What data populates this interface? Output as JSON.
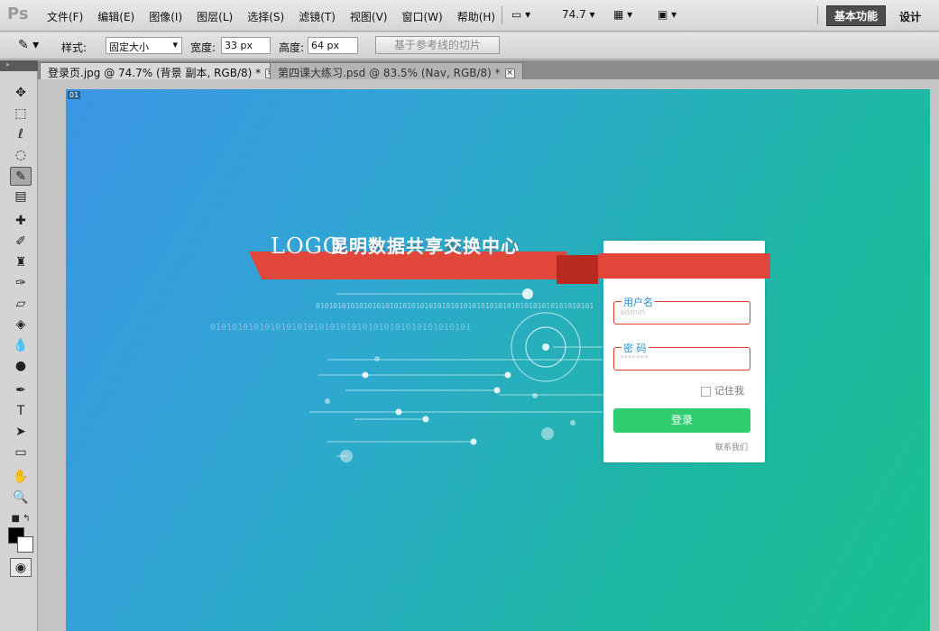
{
  "app": {
    "logo": "Ps"
  },
  "menu": [
    "文件(F)",
    "编辑(E)",
    "图像(I)",
    "图层(L)",
    "选择(S)",
    "滤镜(T)",
    "视图(V)",
    "窗口(W)",
    "帮助(H)"
  ],
  "menubar": {
    "zoom": "74.7",
    "workspace_active": "基本功能",
    "workspace_other": "设计"
  },
  "options": {
    "style_label": "样式:",
    "style_value": "固定大小",
    "width_label": "宽度:",
    "width_value": "33 px",
    "height_label": "高度:",
    "height_value": "64 px",
    "slice_button": "基于参考线的切片"
  },
  "tabs": [
    {
      "label": "登录页.jpg @ 74.7% (背景 副本, RGB/8) *",
      "active": true
    },
    {
      "label": "第四课大练习.psd @ 83.5% (Nav, RGB/8) *",
      "active": false
    }
  ],
  "canvas": {
    "slice_badge": "01",
    "logo": "LOGO",
    "site_title": "昆明数据共享交换中心",
    "binary_top": "0101010101010101010101010101010101010101010101010101010101010101",
    "binary_bottom": "010101010101010101010101010101010101010101010101",
    "login": {
      "username_label": "用户名",
      "username_placeholder": "admin",
      "password_label": "密 码",
      "password_placeholder": "*******",
      "remember": "记住我",
      "submit": "登录",
      "contact": "联系我们"
    }
  },
  "colors": {
    "ribbon": "#e0473a",
    "button": "#2fce70",
    "field_border": "#d9412c",
    "bg_start": "#3c95e4",
    "bg_end": "#1ac08e"
  }
}
